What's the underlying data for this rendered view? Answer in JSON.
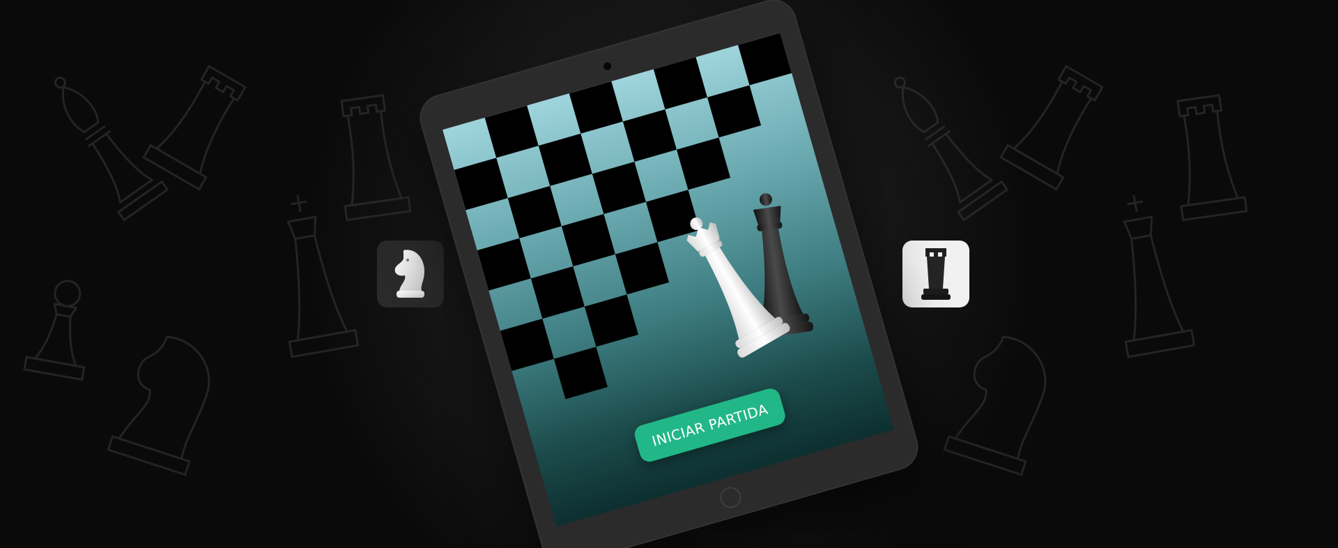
{
  "board": {
    "dark_color": "#000000"
  },
  "screen": {
    "start_button_label": "INICIAR PARTIDA",
    "button_color": "#22b787"
  },
  "tiles": {
    "left_piece": "white-knight-icon",
    "right_piece": "black-rook-icon"
  },
  "colors": {
    "background": "#111111",
    "tablet_body": "#2b2b2b",
    "screen_top": "#9fd4dc",
    "screen_bottom": "#0d2f30"
  }
}
